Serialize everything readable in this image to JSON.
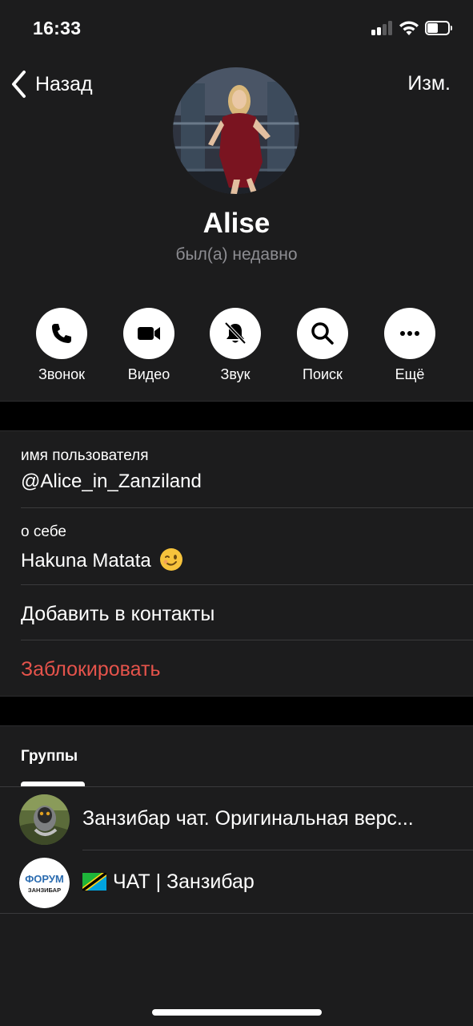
{
  "status_bar": {
    "time": "16:33",
    "battery_level": 0.5
  },
  "nav": {
    "back_label": "Назад",
    "edit_label": "Изм."
  },
  "profile": {
    "name": "Alise",
    "status": "был(а) недавно"
  },
  "actions": [
    {
      "label": "Звонок",
      "icon": "phone-icon"
    },
    {
      "label": "Видео",
      "icon": "video-camera-icon"
    },
    {
      "label": "Звук",
      "icon": "bell-muted-icon"
    },
    {
      "label": "Поиск",
      "icon": "search-icon"
    },
    {
      "label": "Ещё",
      "icon": "more-icon"
    }
  ],
  "info": {
    "username_label": "имя пользователя",
    "username_value": "@Alice_in_Zanziland",
    "bio_label": "о себе",
    "bio_value": "Hakuna Matata",
    "bio_emoji": "winking-face-emoji",
    "add_contact": "Добавить в контакты",
    "block": "Заблокировать"
  },
  "groups": {
    "title": "Группы",
    "items": [
      {
        "name": "Занзибар чат. Оригинальная верс...",
        "avatar": "lemur-photo-avatar"
      },
      {
        "name": "ЧАТ | Занзибар",
        "flag": "tanzania-flag-icon",
        "avatar_text_top": "ФОРУМ",
        "avatar_text_bottom": "ЗАНЗИБАР"
      }
    ]
  },
  "colors": {
    "background": "#1c1c1d",
    "separator": "#000000",
    "destructive": "#e5534b",
    "secondary_text": "#8d8d92"
  }
}
